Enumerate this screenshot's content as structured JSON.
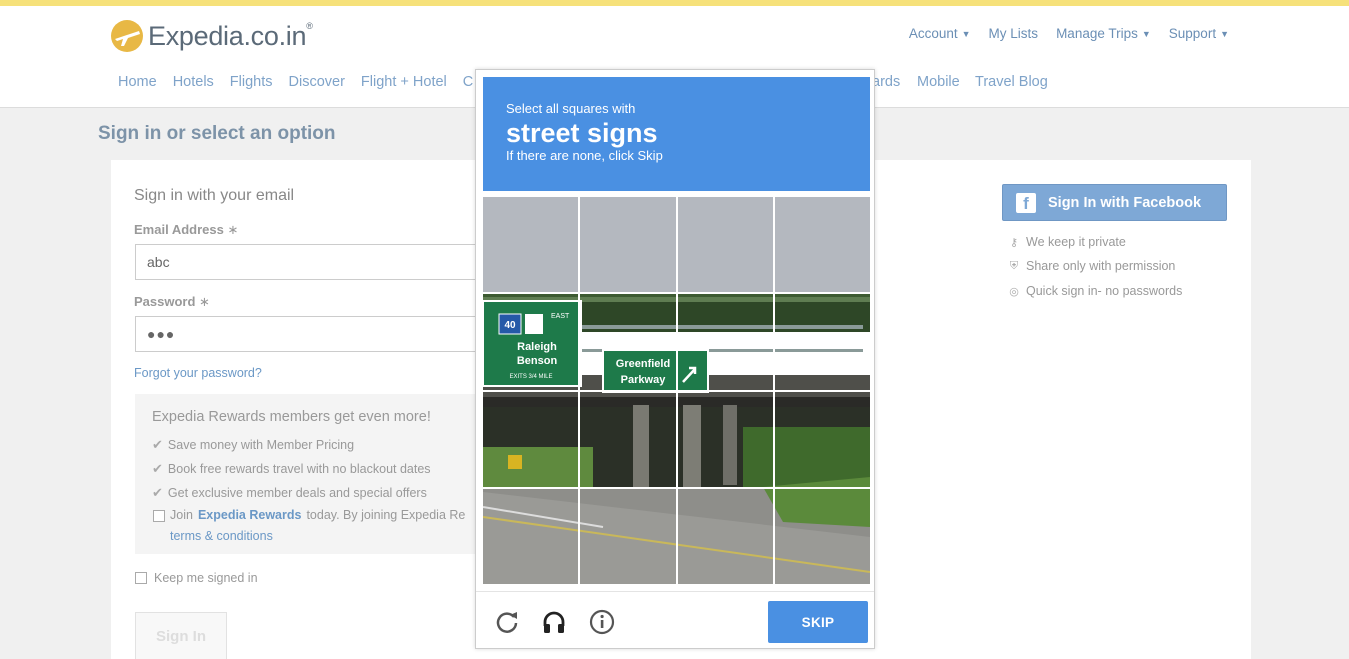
{
  "site": {
    "logo_text": "Expedia.co.in",
    "logo_tm": "®"
  },
  "util_nav": [
    {
      "label": "Account",
      "dropdown": true
    },
    {
      "label": "My Lists",
      "dropdown": false
    },
    {
      "label": "Manage Trips",
      "dropdown": true
    },
    {
      "label": "Support",
      "dropdown": true
    }
  ],
  "main_nav": [
    "Home",
    "Hotels",
    "Flights",
    "Discover",
    "Flight + Hotel",
    "C"
  ],
  "main_nav_right": {
    "partial": "ards",
    "mobile": "Mobile",
    "blog": "Travel Blog"
  },
  "page": {
    "title": "Sign in or select an option"
  },
  "signin": {
    "heading": "Sign in with your email",
    "email_label": "Email Address",
    "email_value": "abc",
    "password_label": "Password",
    "password_value": "●●●",
    "required_mark": "∗",
    "forgot": "Forgot your password?",
    "keep_signed_in": "Keep me signed in",
    "button": "Sign In"
  },
  "rewards": {
    "title": "Expedia Rewards members get even more!",
    "items": [
      "Save money with Member Pricing",
      "Book free rewards travel with no blackout dates",
      "Get exclusive member deals and special offers"
    ],
    "join_prefix": "Join",
    "join_link": "Expedia Rewards",
    "join_suffix": "today. By joining Expedia Re",
    "terms": "terms & conditions"
  },
  "facebook": {
    "button": "Sign In with Facebook",
    "perks": [
      "We keep it private",
      "Share only with permission",
      "Quick sign in- no passwords"
    ]
  },
  "captcha": {
    "instruction_small": "Select all squares with",
    "instruction_big": "street signs",
    "instruction_sub": "If there are none, click Skip",
    "skip": "SKIP",
    "sign1_lines": [
      "EAST",
      "40",
      "Raleigh",
      "Benson",
      "EXITS 3/4 MILE"
    ],
    "sign2_lines": [
      "Greenfield",
      "Parkway"
    ]
  },
  "colors": {
    "accent": "#4a90e2",
    "link": "#6b98c6",
    "facebook": "#7ea8d6",
    "top_stripe": "#f6e17a"
  }
}
